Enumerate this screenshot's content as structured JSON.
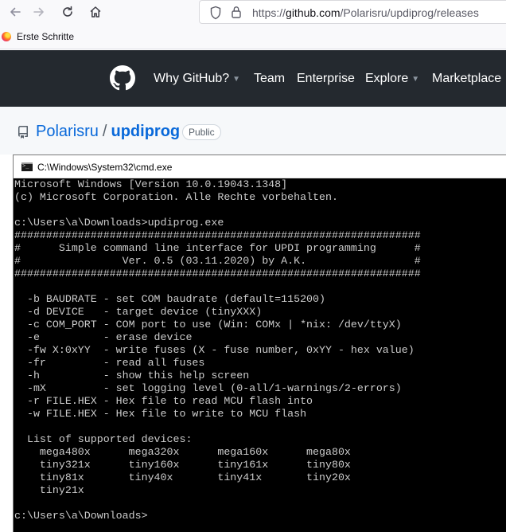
{
  "browser": {
    "url": {
      "prefix": "https://",
      "host": "github.com",
      "path": "/Polarisru/updiprog/releases"
    },
    "icons": {
      "back": "back-arrow-icon",
      "forward": "forward-arrow-icon",
      "reload": "reload-icon",
      "home": "home-icon",
      "shield": "shield-icon",
      "lock": "lock-icon"
    }
  },
  "bookmarks": {
    "items": [
      {
        "label": "Erste Schritte",
        "icon": "firefox-logo-icon"
      }
    ]
  },
  "github_header": {
    "nav": [
      {
        "label": "Why GitHub?",
        "has_dropdown": true
      },
      {
        "label": "Team",
        "has_dropdown": false
      },
      {
        "label": "Enterprise",
        "has_dropdown": false
      },
      {
        "label": "Explore",
        "has_dropdown": true
      },
      {
        "label": "Marketplace",
        "has_dropdown": false
      }
    ]
  },
  "repo": {
    "owner": "Polarisru",
    "separator": "/",
    "name": "updiprog",
    "visibility": "Public"
  },
  "cmd_window": {
    "title": "C:\\Windows\\System32\\cmd.exe",
    "lines": [
      "Microsoft Windows [Version 10.0.19043.1348]",
      "(c) Microsoft Corporation. Alle Rechte vorbehalten.",
      "",
      "c:\\Users\\a\\Downloads>updiprog.exe",
      "################################################################",
      "#      Simple command line interface for UPDI programming      #",
      "#                Ver. 0.5 (03.11.2020) by A.K.                 #",
      "################################################################",
      "",
      "  -b BAUDRATE - set COM baudrate (default=115200)",
      "  -d DEVICE   - target device (tinyXXX)",
      "  -c COM_PORT - COM port to use (Win: COMx | *nix: /dev/ttyX)",
      "  -e          - erase device",
      "  -fw X:0xYY  - write fuses (X - fuse number, 0xYY - hex value)",
      "  -fr         - read all fuses",
      "  -h          - show this help screen",
      "  -mX         - set logging level (0-all/1-warnings/2-errors)",
      "  -r FILE.HEX - Hex file to read MCU flash into",
      "  -w FILE.HEX - Hex file to write to MCU flash",
      "",
      "  List of supported devices:",
      "    mega480x      mega320x      mega160x      mega80x",
      "    tiny321x      tiny160x      tiny161x      tiny80x",
      "    tiny81x       tiny40x       tiny41x       tiny20x",
      "    tiny21x",
      "",
      "c:\\Users\\a\\Downloads>"
    ]
  }
}
